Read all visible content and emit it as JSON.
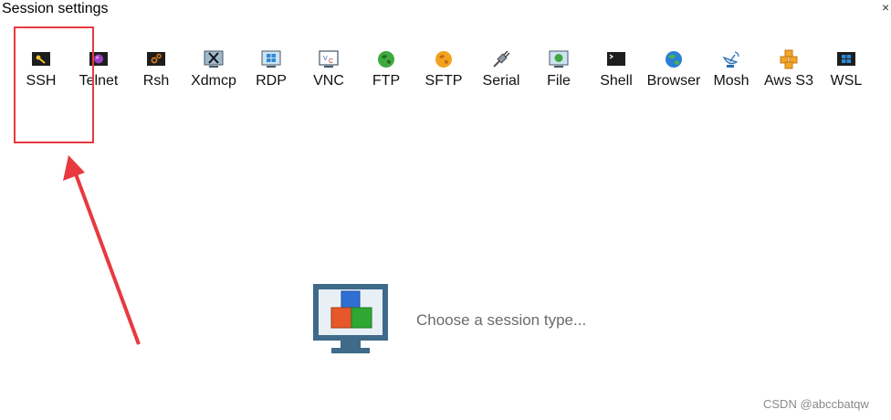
{
  "window": {
    "title": "Session settings",
    "close_glyph": "×"
  },
  "session_types": [
    {
      "label": "SSH",
      "icon": "key-icon"
    },
    {
      "label": "Telnet",
      "icon": "telnet-icon"
    },
    {
      "label": "Rsh",
      "icon": "rsh-icon"
    },
    {
      "label": "Xdmcp",
      "icon": "x-monitor-icon"
    },
    {
      "label": "RDP",
      "icon": "windows-monitor-icon"
    },
    {
      "label": "VNC",
      "icon": "vnc-monitor-icon"
    },
    {
      "label": "FTP",
      "icon": "green-globe-icon"
    },
    {
      "label": "SFTP",
      "icon": "orange-globe-icon"
    },
    {
      "label": "Serial",
      "icon": "serial-plug-icon"
    },
    {
      "label": "File",
      "icon": "file-monitor-icon"
    },
    {
      "label": "Shell",
      "icon": "terminal-icon"
    },
    {
      "label": "Browser",
      "icon": "globe-icon"
    },
    {
      "label": "Mosh",
      "icon": "satellite-dish-icon"
    },
    {
      "label": "Aws S3",
      "icon": "aws-cubes-icon"
    },
    {
      "label": "WSL",
      "icon": "windows-terminal-icon"
    }
  ],
  "main": {
    "placeholder_text": "Choose a session type...",
    "icon": "session-cubes-monitor-icon"
  },
  "annotation": {
    "highlight_color": "#e8393f"
  },
  "watermark": "CSDN @abccbatqw"
}
